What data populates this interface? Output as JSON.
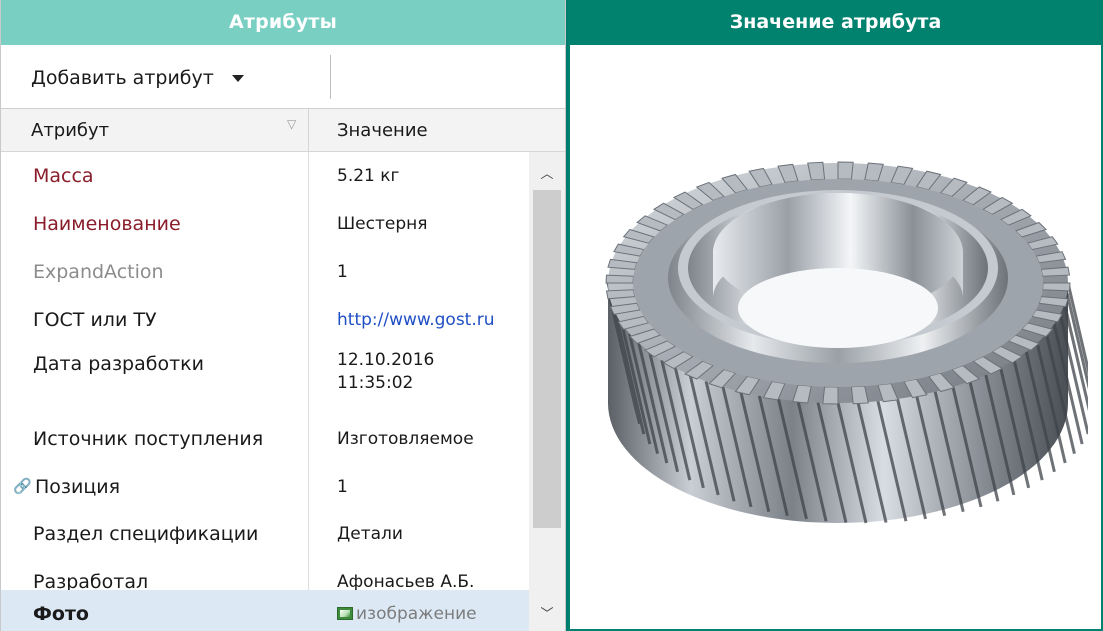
{
  "left_panel": {
    "title": "Атрибуты",
    "toolbar": {
      "add_attribute_label": "Добавить атрибут"
    },
    "columns": {
      "attribute": "Атрибут",
      "value": "Значение"
    },
    "rows": [
      {
        "name": "Масса",
        "value": "5.21 кг"
      },
      {
        "name": "Наименование",
        "value": "Шестерня"
      },
      {
        "name": "ExpandAction",
        "value": "1"
      },
      {
        "name": "ГОСТ или ТУ",
        "value": "http://www.gost.ru"
      },
      {
        "name": "Дата разработки",
        "value_line1": "12.10.2016",
        "value_line2": "11:35:02"
      },
      {
        "name": "Источник поступления",
        "value": "Изготовляемое"
      },
      {
        "name": "Позиция",
        "value": "1"
      },
      {
        "name": "Раздел спецификации",
        "value": "Детали"
      },
      {
        "name": "Разработал",
        "value": "Афонасьев А.Б."
      },
      {
        "name": "Фото",
        "value": "изображение"
      }
    ]
  },
  "right_panel": {
    "title": "Значение атрибута",
    "image_icon": "helical-gear-image"
  },
  "colors": {
    "left_header": "#79cfc2",
    "right_header": "#00826f",
    "attribute_red": "#8a1d2a",
    "link_blue": "#1f4fc4",
    "selected_row": "#dce9f5"
  }
}
